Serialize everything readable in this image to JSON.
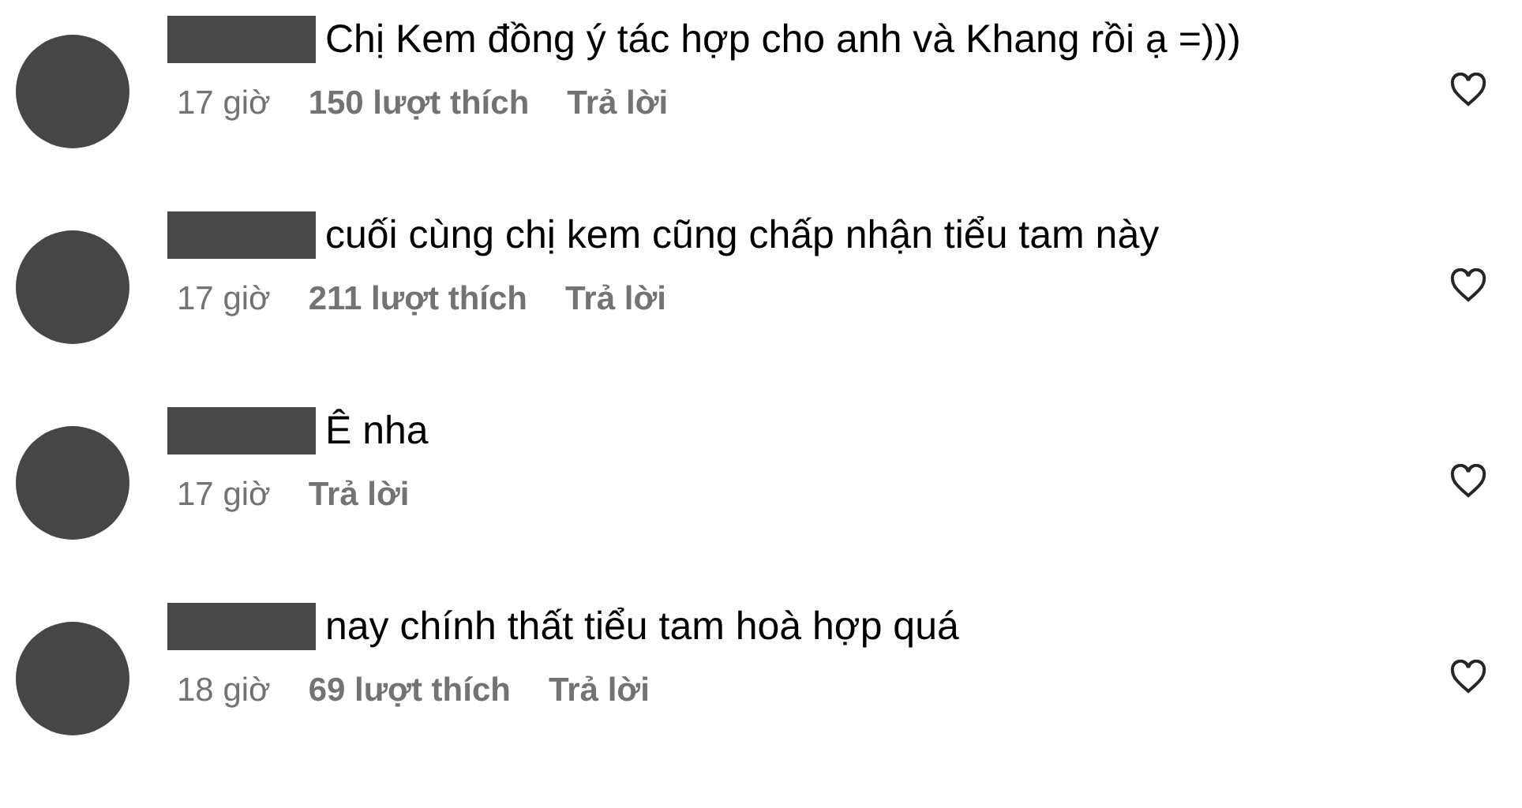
{
  "comments": [
    {
      "text": "Chị Kem đồng ý tác hợp cho anh và Khang rồi ạ =)))",
      "time": "17 giờ",
      "likes": "150 lượt thích",
      "reply": "Trả lời"
    },
    {
      "text": "cuối cùng chị kem cũng chấp nhận tiểu tam này",
      "time": "17 giờ",
      "likes": "211 lượt thích",
      "reply": "Trả lời"
    },
    {
      "text": "Ê nha",
      "time": "17 giờ",
      "reply": "Trả lời"
    },
    {
      "text": "nay chính thất tiểu tam hoà hợp quá",
      "time": "18 giờ",
      "likes": "69 lượt thích",
      "reply": "Trả lời"
    }
  ]
}
